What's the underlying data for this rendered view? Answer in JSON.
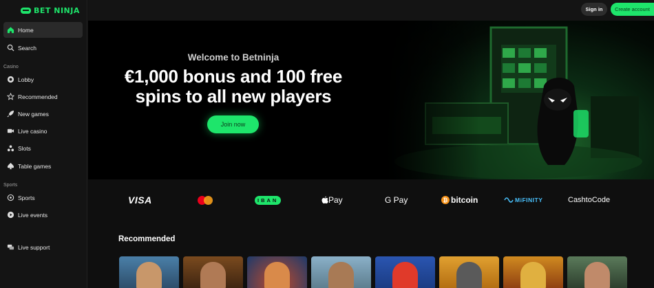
{
  "brand": {
    "name": "BET NINJA",
    "accent": "#1ee56b"
  },
  "sidebar": {
    "items": [
      {
        "label": "Home",
        "icon": "home-icon",
        "active": true
      },
      {
        "label": "Search",
        "icon": "search-icon"
      }
    ],
    "casino_label": "Casino",
    "casino_items": [
      {
        "label": "Lobby",
        "icon": "lobby-icon"
      },
      {
        "label": "Recommended",
        "icon": "star-icon"
      },
      {
        "label": "New games",
        "icon": "rocket-icon"
      },
      {
        "label": "Live casino",
        "icon": "live-casino-icon"
      },
      {
        "label": "Slots",
        "icon": "slots-icon"
      },
      {
        "label": "Table games",
        "icon": "spade-icon"
      }
    ],
    "sports_label": "Sports",
    "sports_items": [
      {
        "label": "Sports",
        "icon": "ball-icon"
      },
      {
        "label": "Live events",
        "icon": "play-icon"
      }
    ],
    "support": {
      "label": "Live support",
      "icon": "chat-icon"
    }
  },
  "topbar": {
    "signin": "Sign in",
    "create": "Create account"
  },
  "hero": {
    "welcome": "Welcome to Betninja",
    "headline_1": "€1,000 bonus and 100 free",
    "headline_2": "spins to all new players",
    "cta": "Join now"
  },
  "payments": {
    "visa": "VISA",
    "iban": "IBAN",
    "applepay": " Pay",
    "gpay": "G Pay",
    "bitcoin": "bitcoin",
    "mifinity": "MiFINITY",
    "cashtocode": "CashtoCode"
  },
  "recommended": {
    "title": "Recommended"
  }
}
